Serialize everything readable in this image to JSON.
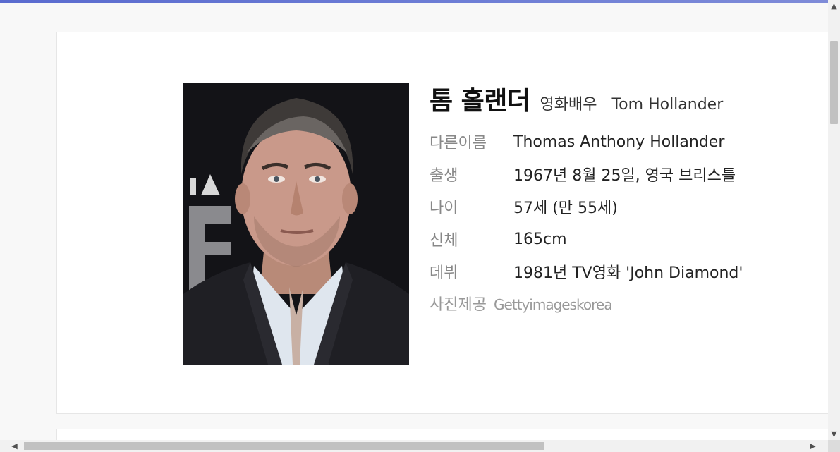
{
  "profile": {
    "name_ko": "톰 홀랜더",
    "occupation": "영화배우",
    "name_en": "Tom Hollander",
    "details": [
      {
        "label": "다른이름",
        "value": "Thomas Anthony Hollander"
      },
      {
        "label": "출생",
        "value": "1967년 8월 25일, 영국 브리스틀"
      },
      {
        "label": "나이",
        "value": "57세 (만 55세)"
      },
      {
        "label": "신체",
        "value": "165cm"
      },
      {
        "label": "데뷔",
        "value": "1981년 TV영화 'John Diamond'"
      }
    ],
    "photo_credit_label": "사진제공",
    "photo_credit_value": "Gettyimageskorea"
  },
  "scrollbars": {
    "up_icon": "▲",
    "down_icon": "▼",
    "left_icon": "◀",
    "right_icon": "▶"
  },
  "colors": {
    "accent_bar": "#6f7fd6",
    "label_gray": "#888888"
  }
}
